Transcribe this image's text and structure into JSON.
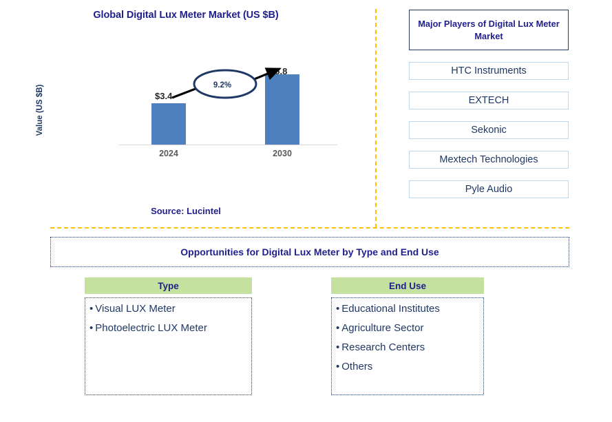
{
  "chart_panel": {
    "title": "Global Digital Lux Meter Market (US $B)",
    "y_axis_label": "Value (US $B)",
    "source": "Source: Lucintel",
    "cagr_label": "9.2%"
  },
  "chart_data": {
    "type": "bar",
    "title": "Global Digital Lux Meter Market (US $B)",
    "xlabel": "",
    "ylabel": "Value (US $B)",
    "categories": [
      "2024",
      "2030"
    ],
    "values": [
      3.4,
      5.8
    ],
    "data_labels": [
      "$3.4",
      "$5.8"
    ],
    "ylim": [
      0,
      6.8
    ],
    "grid": false,
    "legend": "none",
    "annotations": [
      {
        "text": "9.2%",
        "type": "cagr-ellipse",
        "from": "2024",
        "to": "2030"
      }
    ],
    "series_color": "#4E80BD"
  },
  "players": {
    "title": "Major Players of Digital Lux Meter Market",
    "items": [
      {
        "label": "HTC Instruments"
      },
      {
        "label": "EXTECH"
      },
      {
        "label": "Sekonic"
      },
      {
        "label": "Mextech Technologies"
      },
      {
        "label": "Pyle Audio"
      }
    ]
  },
  "opportunities": {
    "title": "Opportunities for Digital Lux Meter by Type and End Use",
    "columns": [
      {
        "header": "Type",
        "items": [
          {
            "label": "Visual LUX Meter"
          },
          {
            "label": "Photoelectric LUX Meter"
          }
        ]
      },
      {
        "header": "End Use",
        "items": [
          {
            "label": "Educational Institutes"
          },
          {
            "label": "Agriculture Sector"
          },
          {
            "label": "Research Centers"
          },
          {
            "label": "Others"
          }
        ]
      }
    ]
  },
  "colors": {
    "bar": "#4E80BD",
    "title_text": "#1F1F8C",
    "body_text": "#1F3864",
    "divider": "#FFC000",
    "segment_header_bg": "#C6E0A0",
    "player_border": "#BDD7EE",
    "tick_text": "#595959"
  },
  "bullet": "•"
}
